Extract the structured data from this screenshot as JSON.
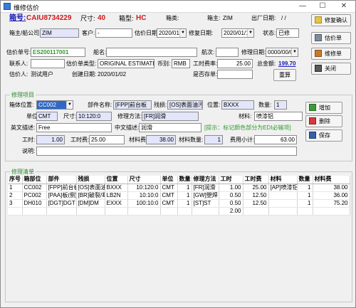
{
  "window": {
    "title": "维修估价",
    "minimize": "—",
    "maximize": "☐",
    "close": "✕"
  },
  "header": {
    "box_label": "箱号:",
    "box_no": "CAIU8734229",
    "size_label": "尺寸:",
    "size": "40",
    "type_label": "箱型:",
    "type": "HC",
    "category_label": "箱类:",
    "category": "",
    "owner_label": "箱主:",
    "owner": "ZIM",
    "exit_date_label": "出厂日期:",
    "exit_date": "/ /"
  },
  "row1": {
    "company_label": "箱主/船公司:",
    "company": "ZIM",
    "customer_label": "客户:",
    "customer": "-",
    "est_date_label": "估价日期:",
    "est_date": "2020/01/02",
    "repair_date_label": "修复日期:",
    "repair_date": "2020/01/17",
    "status_label": "状态:",
    "status": "已修"
  },
  "row2": {
    "est_no_label": "估价单号:",
    "est_no": "ES200117001",
    "ship_label": "船名:",
    "ship": "",
    "voyage_label": "航次:",
    "voyage": "",
    "repair_time_label": "修理日期:",
    "repair_time": "0000/00/00"
  },
  "row3": {
    "contact_label": "联系人:",
    "contact": "",
    "est_type_label": "估价单类型:",
    "est_type": "ORIGINAL ESTIMATE",
    "currency_label": "币别:",
    "currency": "RMB",
    "hour_rate_label": "工时费率:",
    "hour_rate": "25.00",
    "total_label": "总金额:",
    "total": "199.70"
  },
  "row4": {
    "estimator_label": "估价人:",
    "estimator": "测试用户",
    "created_label": "创建日期:",
    "created": "2020/01/02",
    "payable_label": "是否存单:",
    "payable": "",
    "recalc": "重算"
  },
  "side_buttons": {
    "confirm": "修复确认",
    "estimate": "估价单",
    "repair_form": "维修单",
    "close": "关闭"
  },
  "repair_item": {
    "group_title": "修理项目",
    "position_label": "箱体位置:",
    "position": "CC002",
    "part_label": "部件名称:",
    "part": "[FPP]前台板",
    "damage_label": "残损:",
    "damage": "[OS]表面油污",
    "loc_label": "位置:",
    "loc": "BXXX",
    "qty_label": "数量:",
    "qty": "1",
    "unit_label": "单位:",
    "unit": "CMT",
    "size_label": "尺寸:",
    "size": "10:120:0",
    "method_label": "修理方法:",
    "method": "[FR]润滑",
    "material_label": "材料:",
    "material": "喷漆铝",
    "en_label": "英文描述:",
    "en": "Free",
    "cn_label": "中文描述:",
    "cn": "润滑",
    "hint": "[提示：标记颜色部分为EDI必输项]",
    "hours_label": "工时:",
    "hours": "1.00",
    "labor_label": "工时费:",
    "labor": "25.00",
    "matcost_label": "材料费:",
    "matcost": "38.00",
    "matqty_label": "材料数量:",
    "matqty": "1",
    "subtotal_label": "费用小计:",
    "subtotal": "63.00",
    "note_label": "说明:",
    "note": "",
    "add": "增加",
    "delete": "删除",
    "save": "保存"
  },
  "list": {
    "group_title": "修理清单",
    "columns": [
      "序号",
      "箱部位",
      "部件",
      "残损",
      "位置",
      "尺寸",
      "单位",
      "数量",
      "修理方法",
      "工时",
      "工时费",
      "材料",
      "数量",
      "材料费"
    ],
    "rows": [
      [
        "1",
        "CC002",
        "[FPP]前台板",
        "[OS]表面油污",
        "BXXX",
        "10:120:0",
        "CMT",
        "1",
        "[FR]润滑",
        "1.00",
        "25.00",
        "[AP]喷漆铝",
        "1",
        "38.00"
      ],
      [
        "2",
        "PC002",
        "[PAA]板(侧)",
        "[BR]破裂/霉",
        "LB2N",
        "10:10:0",
        "CMT",
        "1",
        "[GW]塑焊",
        "0.50",
        "12.50",
        "",
        "1",
        "36.00"
      ],
      [
        "3",
        "DH010",
        "[DGT]DGT",
        "[DM]DM",
        "EXXX",
        "100:10:0",
        "CMT",
        "1",
        "[ST]ST",
        "0.50",
        "12.50",
        "",
        "1",
        "75.20"
      ]
    ],
    "total_hours": "2.00"
  },
  "colors": {
    "box_no": "#d11a1a",
    "link": "#1a1ab8",
    "hint": "#2e9a2e",
    "blue_field": "#e3e6fb",
    "highlight": "#3168c8"
  }
}
